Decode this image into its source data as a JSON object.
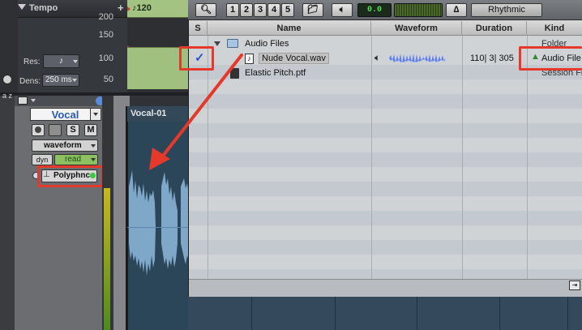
{
  "tempo": {
    "label": "Tempo",
    "plus": "+",
    "marker_value": "120",
    "ruler": [
      "200",
      "150",
      "100",
      "50"
    ]
  },
  "controls": {
    "res_label": "Res:",
    "dens_label": "Dens:",
    "dens_value": "250 ms"
  },
  "sidebar": {
    "az_label": "a z"
  },
  "track": {
    "name": "Vocal",
    "solo": "S",
    "mute": "M",
    "view": "waveform",
    "automation_left": "dyn",
    "automation_mode": "read",
    "elastic_mode": "Polyphnc",
    "clip_name": "Vocal-01"
  },
  "workspace": {
    "toolbar": {
      "numbers": [
        "1",
        "2",
        "3",
        "4",
        "5"
      ],
      "counter": "0.0",
      "mode": "Rhythmic"
    },
    "columns": {
      "s": "S",
      "name": "Name",
      "waveform": "Waveform",
      "duration": "Duration",
      "kind": "Kind"
    },
    "rows": [
      {
        "name": "Audio Files",
        "kind": "Folder",
        "duration": "",
        "selected": false,
        "type": "folder"
      },
      {
        "name": "Nude Vocal.wav",
        "kind": "Audio File",
        "duration": "110| 3| 305",
        "selected": true,
        "check": "✓",
        "type": "audio"
      },
      {
        "name": "Elastic Pitch.ptf",
        "kind": "Session File",
        "duration": "",
        "selected": false,
        "type": "session"
      }
    ]
  },
  "colors": {
    "annotation_red": "#e53a2b",
    "check_blue": "#2a55c5",
    "waveform_blue": "#5f7ff5"
  }
}
